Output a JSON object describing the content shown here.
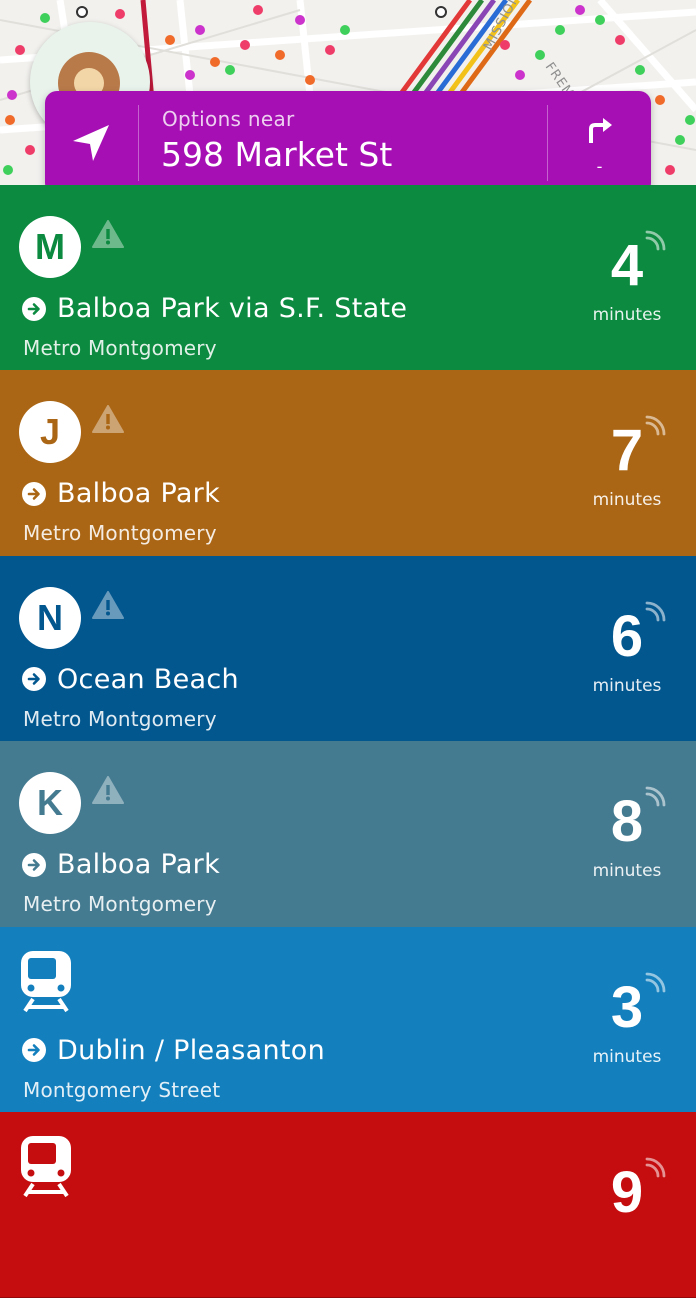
{
  "header": {
    "options_label": "Options near",
    "address": "598 Market St",
    "direction_value": "-",
    "icons": [
      "location-arrow-icon",
      "turn-right-icon"
    ]
  },
  "map": {
    "street_labels": [
      "MISSION ST",
      "FREM"
    ]
  },
  "routes": [
    {
      "badge": "M",
      "icon": "badge",
      "color": "#0b8a40",
      "text_color": "#0b8a40",
      "destination": "Balboa Park via S.F. State",
      "stop": "Metro Montgomery",
      "minutes": "4",
      "minutes_label": "minutes",
      "has_alert": true
    },
    {
      "badge": "J",
      "icon": "badge",
      "color": "#ab6615",
      "text_color": "#ab6615",
      "destination": "Balboa Park",
      "stop": "Metro Montgomery",
      "minutes": "7",
      "minutes_label": "minutes",
      "has_alert": true
    },
    {
      "badge": "N",
      "icon": "badge",
      "color": "#03578f",
      "text_color": "#03578f",
      "destination": "Ocean Beach",
      "stop": "Metro Montgomery",
      "minutes": "6",
      "minutes_label": "minutes",
      "has_alert": true
    },
    {
      "badge": "K",
      "icon": "badge",
      "color": "#457b91",
      "text_color": "#457b91",
      "destination": "Balboa Park",
      "stop": "Metro Montgomery",
      "minutes": "8",
      "minutes_label": "minutes",
      "has_alert": true
    },
    {
      "badge": "",
      "icon": "train-icon",
      "color": "#137fbd",
      "text_color": "#137fbd",
      "destination": "Dublin / Pleasanton",
      "stop": "Montgomery Street",
      "minutes": "3",
      "minutes_label": "minutes",
      "has_alert": false
    },
    {
      "badge": "",
      "icon": "train-icon",
      "color": "#c50d0f",
      "text_color": "#c50d0f",
      "destination": "",
      "stop": "",
      "minutes": "9",
      "minutes_label": "",
      "has_alert": false
    }
  ]
}
